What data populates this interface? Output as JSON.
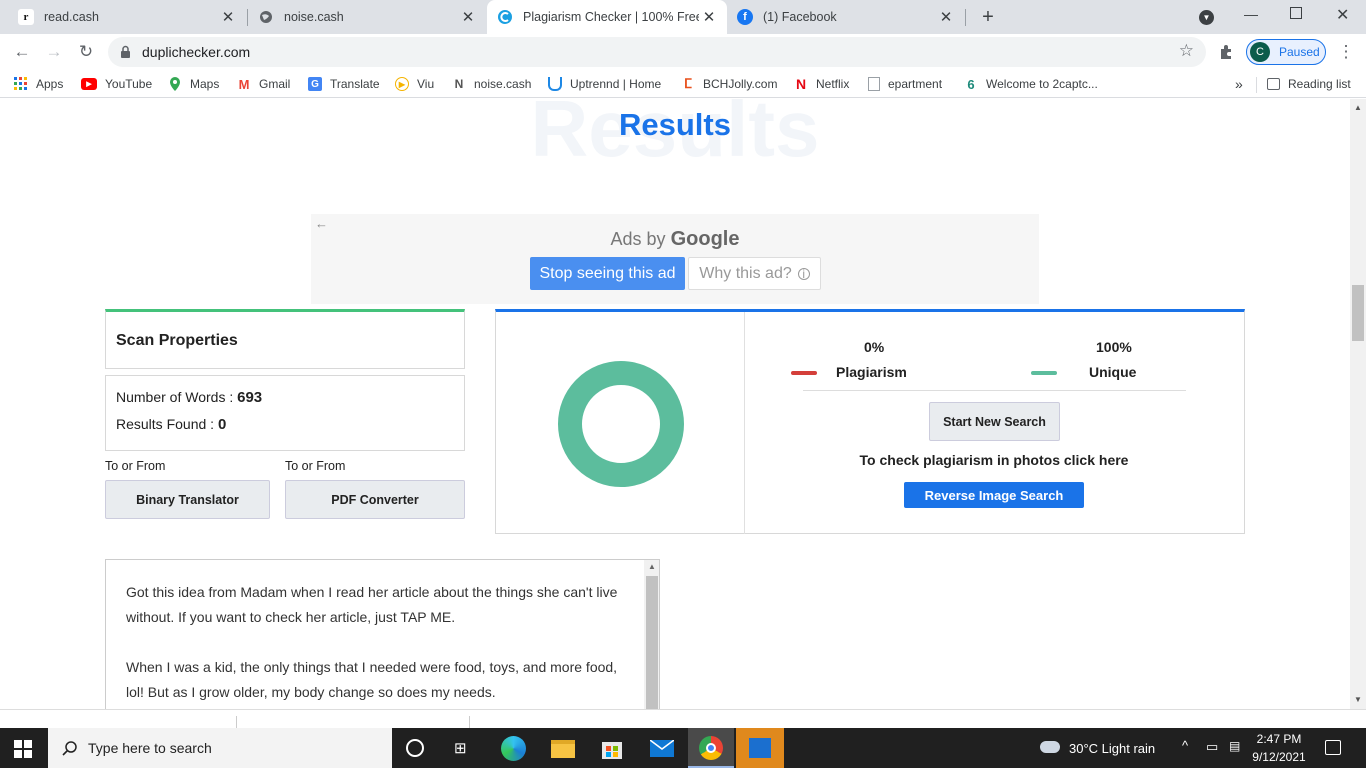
{
  "tabs": [
    {
      "title": "read.cash",
      "icon": "r"
    },
    {
      "title": "noise.cash",
      "icon": "globe"
    },
    {
      "title": "Plagiarism Checker | 100% Free a",
      "icon": "c",
      "active": true
    },
    {
      "title": "(1) Facebook",
      "icon": "f"
    }
  ],
  "toolbar": {
    "url": "duplichecker.com",
    "profile_initial": "C",
    "profile_status": "Paused"
  },
  "bookmarks": [
    {
      "label": "Apps"
    },
    {
      "label": "YouTube"
    },
    {
      "label": "Maps"
    },
    {
      "label": "Gmail"
    },
    {
      "label": "Translate"
    },
    {
      "label": "Viu"
    },
    {
      "label": "noise.cash"
    },
    {
      "label": "Uptrennd | Home"
    },
    {
      "label": "BCHJolly.com"
    },
    {
      "label": "Netflix"
    },
    {
      "label": "epartment"
    },
    {
      "label": "Welcome to 2captc..."
    }
  ],
  "reading_list": "Reading list",
  "overflow": "»",
  "page": {
    "results_bg_text": "Results",
    "results_title": "Results",
    "ad": {
      "ads_by": "Ads by",
      "google": "Google",
      "stop_seeing": "Stop seeing this ad",
      "why_this": "Why this ad?",
      "back_arrow": "←"
    },
    "scan": {
      "title": "Scan Properties",
      "words_label": "Number of Words :",
      "words_value": "693",
      "results_label": "Results Found :",
      "results_value": "0",
      "to_from_1": "To or From",
      "to_from_2": "To or From",
      "binary": "Binary Translator",
      "pdf": "PDF Converter"
    },
    "result": {
      "plag_pct": "0%",
      "plag_label": "Plagiarism",
      "uniq_pct": "100%",
      "uniq_label": "Unique",
      "start_new": "Start New Search",
      "photos_text": "To check plagiarism in photos click here",
      "reverse": "Reverse Image Search",
      "plagiarism_fraction": 0,
      "colors": {
        "plag": "#d43f3a",
        "unique": "#5cbd9d"
      }
    },
    "text": {
      "p1": "Got this idea from Madam  when I read her article about the things she can't live without. If you want to check her article, just TAP ME.",
      "p2": "When I was a kid, the only things that I needed were food, toys, and more food, lol! But as I grow older, my body change so does my needs."
    }
  },
  "taskbar": {
    "search_placeholder": "Type here to search",
    "weather": "30°C  Light rain",
    "time": "2:47 PM",
    "date": "9/12/2021"
  }
}
